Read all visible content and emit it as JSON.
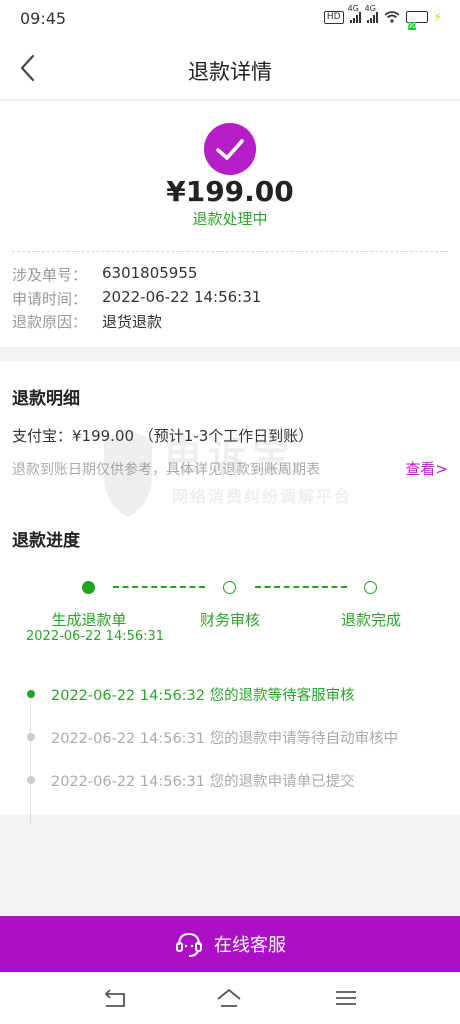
{
  "status_bar": {
    "time": "09:45",
    "hd": "HD",
    "net1": "4G",
    "net2": "4G",
    "battery": "90"
  },
  "header": {
    "title": "退款详情"
  },
  "summary": {
    "amount": "¥199.00",
    "status": "退款处理中",
    "rows": [
      {
        "label": "涉及单号：",
        "value": "6301805955"
      },
      {
        "label": "申请时间：",
        "value": "2022-06-22 14:56:31"
      },
      {
        "label": "退款原因：",
        "value": "退货退款"
      }
    ]
  },
  "detail": {
    "title": "退款明细",
    "pay_line": "支付宝：¥199.00 （预计1-3个工作日到账）",
    "note": "退款到账日期仅供参考，具体详见退款到账周期表",
    "view_link": "查看>"
  },
  "watermark": {
    "main": "电诉宝",
    "sub": "网络消费纠纷调解平台"
  },
  "progress": {
    "title": "退款进度",
    "steps": [
      {
        "label": "生成退款单",
        "time": "2022-06-22 14:56:31"
      },
      {
        "label": "财务审核"
      },
      {
        "label": "退款完成"
      }
    ],
    "timeline": [
      {
        "text": "2022-06-22 14:56:32 您的退款等待客服审核"
      },
      {
        "text": "2022-06-22 14:56:31 您的退款申请等待自动审核中"
      },
      {
        "text": "2022-06-22 14:56:31 您的退款申请单已提交"
      }
    ]
  },
  "bottom": {
    "service_label": "在线客服"
  },
  "colors": {
    "accent": "#b61fc7",
    "button": "#ac10c6",
    "success": "#2aa52a"
  }
}
